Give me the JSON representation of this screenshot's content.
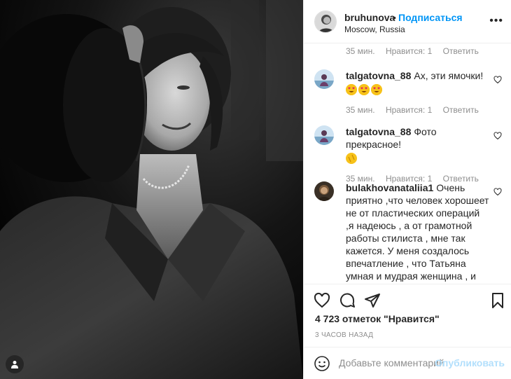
{
  "post": {
    "author": {
      "username": "bruhunova",
      "follow_label": "Подписаться",
      "separator": "•",
      "location": "Moscow, Russia"
    },
    "more_icon": "more-horizontal-icon"
  },
  "comments": [
    {
      "username": "",
      "text": "",
      "time": "35 мин.",
      "likes": "Нравится: 1",
      "reply": "Ответить"
    },
    {
      "username": "talgatovna_88",
      "text": "Ах, эти ямочки!",
      "emojis": [
        "heart-eyes",
        "heart-eyes",
        "heart-eyes"
      ],
      "time": "35 мин.",
      "likes": "Нравится: 1",
      "reply": "Ответить"
    },
    {
      "username": "talgatovna_88",
      "text": "Фото прекрасное!",
      "emojis": [
        "clapping-hands"
      ],
      "time": "35 мин.",
      "likes": "Нравится: 1",
      "reply": "Ответить"
    },
    {
      "username": "bulakhovanataliia1",
      "text": "Очень приятно ,что человек хорошеет не от пластических операций ,я надеюсь , а от грамотной работы стилиста , мне так кажется. У меня создалось впечатление , что Татьяна умная и мудрая женщина , и не будет пока в молодом возрасте что"
    }
  ],
  "actions": {
    "like_icon": "heart-icon",
    "comment_icon": "comment-icon",
    "share_icon": "share-icon",
    "save_icon": "bookmark-icon"
  },
  "likes_text": "4 723 отметок \"Нравится\"",
  "posted_time": "3 часов назад",
  "add_comment": {
    "placeholder": "Добавьте комментарий...",
    "publish_label": "Опубликовать"
  },
  "colors": {
    "accent": "#0095f6",
    "publish_disabled": "#b2dffc",
    "muted": "#8e8e8e",
    "text": "#262626"
  }
}
